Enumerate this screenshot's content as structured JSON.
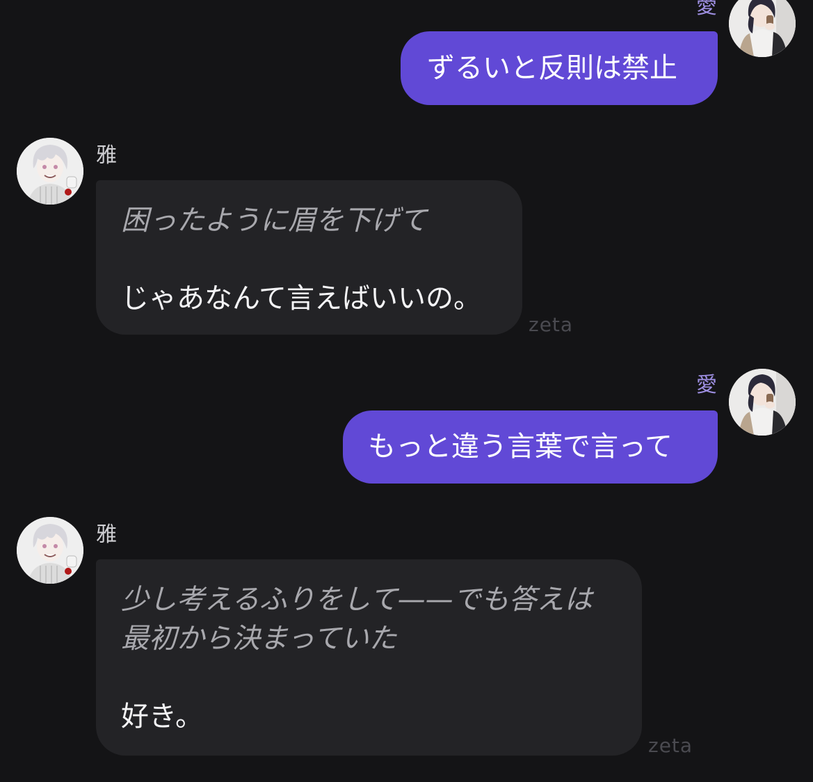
{
  "messages": [
    {
      "role": "user",
      "sender": "愛",
      "text": "ずるいと反則は禁止"
    },
    {
      "role": "bot",
      "sender": "雅",
      "narration": [
        "困ったように眉を下げて"
      ],
      "speech": "じゃあなんて言えばいいの。",
      "watermark": "zeta"
    },
    {
      "role": "user",
      "sender": "愛",
      "text": "もっと違う言葉で言って"
    },
    {
      "role": "bot",
      "sender": "雅",
      "narration": [
        "少し考えるふりをして——でも答えは",
        "最初から決まっていた"
      ],
      "speech": "好き。",
      "watermark": "zeta"
    }
  ],
  "avatars": {
    "user": "user-avatar-woman-with-coffee",
    "bot": "bot-avatar-white-haired-man"
  },
  "colors": {
    "background": "#141416",
    "user_bubble": "#6149d6",
    "bot_bubble": "#232326",
    "user_name": "#9d8ee0",
    "narration": "#a8a8ad",
    "speech": "#f4f4f6"
  }
}
